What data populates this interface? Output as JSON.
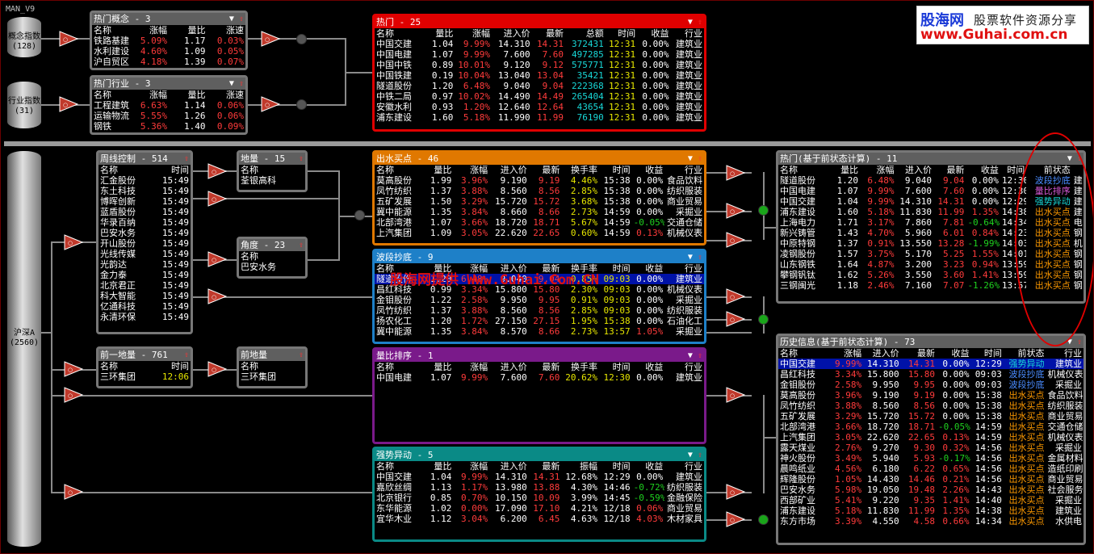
{
  "app": {
    "title": "MAN_V9"
  },
  "logo": {
    "brand": "股海网",
    "slogan": "股票软件资源分享",
    "url": "www.Guhai.com.cn"
  },
  "watermark": "股海网提供 Www.Guhai.Com.CN",
  "sources": {
    "concept": "概念指数",
    "concept_n": "(128)",
    "industry": "行业指数",
    "industry_n": "(31)",
    "market": "沪深A",
    "market_n": "(2560)"
  },
  "hot_concept": {
    "title": "热门概念 - 3",
    "cols": [
      "名称",
      "涨幅",
      "量比",
      "涨速"
    ],
    "rows": [
      [
        "铁路基建",
        "5.09%",
        "1.17",
        "0.03%"
      ],
      [
        "水利建设",
        "4.60%",
        "1.09",
        "0.05%"
      ],
      [
        "沪自贸区",
        "4.18%",
        "1.39",
        "0.07%"
      ]
    ]
  },
  "hot_industry": {
    "title": "热门行业 - 3",
    "cols": [
      "名称",
      "涨幅",
      "量比",
      "涨速"
    ],
    "rows": [
      [
        "工程建筑",
        "6.63%",
        "1.14",
        "0.06%"
      ],
      [
        "运输物流",
        "5.55%",
        "1.26",
        "0.06%"
      ],
      [
        "钢铁",
        "5.36%",
        "1.40",
        "0.09%"
      ]
    ]
  },
  "hot": {
    "title": "热门 - 25",
    "cols": [
      "名称",
      "量比",
      "涨幅",
      "进入价",
      "最新",
      "总额",
      "时间",
      "收益",
      "行业"
    ],
    "rows": [
      [
        "中国交建",
        "1.04",
        "9.99%",
        "14.310",
        "14.31",
        "372431",
        "12:31",
        "0.00%",
        "建筑业"
      ],
      [
        "中国电建",
        "1.07",
        "9.99%",
        "7.600",
        "7.60",
        "497285",
        "12:31",
        "0.00%",
        "建筑业"
      ],
      [
        "中国中铁",
        "0.89",
        "10.01%",
        "9.120",
        "9.12",
        "575771",
        "12:31",
        "0.00%",
        "建筑业"
      ],
      [
        "中国铁建",
        "0.19",
        "10.04%",
        "13.040",
        "13.04",
        "35421",
        "12:31",
        "0.00%",
        "建筑业"
      ],
      [
        "隧道股份",
        "1.20",
        "6.48%",
        "9.040",
        "9.04",
        "222368",
        "12:31",
        "0.00%",
        "建筑业"
      ],
      [
        "中铁二局",
        "0.97",
        "10.02%",
        "14.490",
        "14.49",
        "265404",
        "12:31",
        "0.00%",
        "建筑业"
      ],
      [
        "安徽水利",
        "0.93",
        "1.20%",
        "12.640",
        "12.64",
        "43654",
        "12:31",
        "0.00%",
        "建筑业"
      ],
      [
        "浦东建设",
        "1.60",
        "5.18%",
        "11.990",
        "11.99",
        "76190",
        "12:31",
        "0.00%",
        "建筑业"
      ]
    ]
  },
  "zhouxian": {
    "title": "周线控制 - 514",
    "cols": [
      "名称",
      "时间"
    ],
    "rows": [
      [
        "汇金股份",
        "15:49"
      ],
      [
        "东土科技",
        "15:49"
      ],
      [
        "博晖创新",
        "15:49"
      ],
      [
        "蓝盾股份",
        "15:49"
      ],
      [
        "华录百纳",
        "15:49"
      ],
      [
        "巴安水务",
        "15:49"
      ],
      [
        "开山股份",
        "15:49"
      ],
      [
        "光线传媒",
        "15:49"
      ],
      [
        "光韵达",
        "15:49"
      ],
      [
        "金力泰",
        "15:49"
      ],
      [
        "北京君正",
        "15:49"
      ],
      [
        "科大智能",
        "15:49"
      ],
      [
        "亿通科技",
        "15:49"
      ],
      [
        "永清环保",
        "15:49"
      ]
    ]
  },
  "diliang": {
    "title": "地量 - 15",
    "cols": [
      "名称"
    ],
    "rows": [
      [
        "荃银高科"
      ]
    ]
  },
  "jiaodu": {
    "title": "角度 - 23",
    "cols": [
      "名称"
    ],
    "rows": [
      [
        "巴安水务"
      ]
    ]
  },
  "qianyi": {
    "title": "前一地量 - 761",
    "cols": [
      "名称",
      "时间"
    ],
    "rows": [
      [
        "三环集团",
        "12:06"
      ]
    ]
  },
  "qiandiliang": {
    "title": "前地量",
    "cols": [
      "名称"
    ],
    "rows": [
      [
        "三环集团"
      ]
    ]
  },
  "chushui": {
    "title": "出水买点 - 46",
    "cols": [
      "名称",
      "量比",
      "涨幅",
      "进入价",
      "最新",
      "换手率",
      "时间",
      "收益",
      "行业"
    ],
    "rows": [
      [
        "莫高股份",
        "1.99",
        "3.96%",
        "9.190",
        "9.19",
        "4.46%",
        "15:38",
        "0.00%",
        "食品饮料"
      ],
      [
        "凤竹纺织",
        "1.37",
        "3.88%",
        "8.560",
        "8.56",
        "2.85%",
        "15:38",
        "0.00%",
        "纺织服装"
      ],
      [
        "五矿发展",
        "1.50",
        "3.29%",
        "15.720",
        "15.72",
        "3.68%",
        "15:38",
        "0.00%",
        "商业贸易"
      ],
      [
        "冀中能源",
        "1.35",
        "3.84%",
        "8.660",
        "8.66",
        "2.73%",
        "14:59",
        "0.00%",
        "采掘业"
      ],
      [
        "北部湾港",
        "1.07",
        "3.66%",
        "18.720",
        "18.71",
        "5.67%",
        "14:59",
        "-0.05%",
        "交通仓储"
      ],
      [
        "上汽集团",
        "1.09",
        "3.05%",
        "22.620",
        "22.65",
        "0.60%",
        "14:59",
        "0.13%",
        "机械仪表"
      ]
    ]
  },
  "boduan": {
    "title": "波段抄底 - 9",
    "cols": [
      "名称",
      "量比",
      "涨幅",
      "进入价",
      "最新",
      "换手率",
      "时间",
      "收益",
      "行业"
    ],
    "rows": [
      [
        "隧道股份",
        "1.20",
        "6.48%",
        "9.040",
        "9.04",
        "0.85%",
        "09:03",
        "0.00%",
        "建筑业"
      ],
      [
        "昌红科技",
        "0.99",
        "3.34%",
        "15.800",
        "15.80",
        "2.30%",
        "09:03",
        "0.00%",
        "机械仪表"
      ],
      [
        "金钼股份",
        "1.22",
        "2.58%",
        "9.950",
        "9.95",
        "0.91%",
        "09:03",
        "0.00%",
        "采掘业"
      ],
      [
        "凤竹纺织",
        "1.37",
        "3.88%",
        "8.560",
        "8.56",
        "2.85%",
        "09:03",
        "0.00%",
        "纺织服装"
      ],
      [
        "扬农化工",
        "1.20",
        "1.72%",
        "27.150",
        "27.15",
        "1.95%",
        "15:38",
        "0.00%",
        "石油化工"
      ],
      [
        "冀中能源",
        "1.35",
        "3.84%",
        "8.570",
        "8.66",
        "2.73%",
        "13:57",
        "1.05%",
        "采掘业"
      ]
    ]
  },
  "liangbi": {
    "title": "量比排序 - 1",
    "cols": [
      "名称",
      "量比",
      "涨幅",
      "进入价",
      "最新",
      "换手率",
      "时间",
      "收益",
      "行业"
    ],
    "rows": [
      [
        "中国电建",
        "1.07",
        "9.99%",
        "7.600",
        "7.60",
        "20.62%",
        "12:30",
        "0.00%",
        "建筑业"
      ]
    ]
  },
  "qiangshi": {
    "title": "强势异动 - 5",
    "cols": [
      "名称",
      "量比",
      "涨幅",
      "进入价",
      "最新",
      "振幅",
      "时间",
      "收益",
      "行业"
    ],
    "rows": [
      [
        "中国交建",
        "1.04",
        "9.99%",
        "14.310",
        "14.31",
        "12.68%",
        "12:29",
        "0.00%",
        "建筑业"
      ],
      [
        "嘉欣丝绸",
        "1.13",
        "1.17%",
        "13.980",
        "13.88",
        "4.30%",
        "14:46",
        "-0.72%",
        "纺织服装"
      ],
      [
        "北京银行",
        "0.85",
        "0.70%",
        "10.150",
        "10.09",
        "3.99%",
        "14:45",
        "-0.59%",
        "金融保险"
      ],
      [
        "东华能源",
        "1.02",
        "0.00%",
        "17.090",
        "17.10",
        "4.21%",
        "12/18",
        "0.06%",
        "商业贸易"
      ],
      [
        "宜华木业",
        "1.12",
        "3.04%",
        "6.200",
        "6.45",
        "4.63%",
        "12/18",
        "4.03%",
        "木材家具"
      ]
    ]
  },
  "hot_prev": {
    "title": "热门(基于前状态计算) - 11",
    "cols": [
      "名称",
      "量比",
      "涨幅",
      "进入价",
      "最新",
      "收益",
      "时间",
      "前状态",
      ""
    ],
    "rows": [
      [
        "隧道股份",
        "1.20",
        "6.48%",
        "9.040",
        "9.04",
        "0.00%",
        "12:30",
        "波段抄底",
        "建"
      ],
      [
        "中国电建",
        "1.07",
        "9.99%",
        "7.600",
        "7.60",
        "0.00%",
        "12:30",
        "量比排序",
        "建"
      ],
      [
        "中国交建",
        "1.04",
        "9.99%",
        "14.310",
        "14.31",
        "0.00%",
        "12:29",
        "强势异动",
        "建"
      ],
      [
        "浦东建设",
        "1.60",
        "5.18%",
        "11.830",
        "11.99",
        "1.35%",
        "14:38",
        "出水买点",
        "建"
      ],
      [
        "上海电力",
        "1.71",
        "3.17%",
        "7.860",
        "7.81",
        "-0.64%",
        "14:34",
        "出水买点",
        "电"
      ],
      [
        "新兴铸管",
        "1.43",
        "4.70%",
        "5.960",
        "6.01",
        "0.84%",
        "14:23",
        "出水买点",
        "钢"
      ],
      [
        "中原特钢",
        "1.37",
        "0.91%",
        "13.550",
        "13.28",
        "-1.99%",
        "14:03",
        "出水买点",
        "机"
      ],
      [
        "凌钢股份",
        "1.57",
        "3.75%",
        "5.170",
        "5.25",
        "1.55%",
        "14:01",
        "出水买点",
        "钢"
      ],
      [
        "山东钢铁",
        "1.64",
        "4.87%",
        "3.200",
        "3.23",
        "0.94%",
        "13:59",
        "出水买点",
        "钢"
      ],
      [
        "攀钢钒钛",
        "1.62",
        "5.26%",
        "3.550",
        "3.60",
        "1.41%",
        "13:59",
        "出水买点",
        "钢"
      ],
      [
        "三钢闽光",
        "1.18",
        "2.46%",
        "7.160",
        "7.07",
        "-1.26%",
        "13:57",
        "出水买点",
        "钢"
      ]
    ]
  },
  "history": {
    "title": "历史信息(基于前状态计算) - 73",
    "cols": [
      "名称",
      "涨幅",
      "进入价",
      "最新",
      "收益",
      "时间",
      "前状态",
      "行业"
    ],
    "rows": [
      [
        "中国交建",
        "9.99%",
        "14.310",
        "14.31",
        "0.00%",
        "12:29",
        "强势异动",
        "建筑业"
      ],
      [
        "昌红科技",
        "3.34%",
        "15.800",
        "15.80",
        "0.00%",
        "09:03",
        "波段抄底",
        "机械仪表"
      ],
      [
        "金钼股份",
        "2.58%",
        "9.950",
        "9.95",
        "0.00%",
        "09:03",
        "波段抄底",
        "采掘业"
      ],
      [
        "莫高股份",
        "3.96%",
        "9.190",
        "9.19",
        "0.00%",
        "15:38",
        "出水买点",
        "食品饮料"
      ],
      [
        "凤竹纺织",
        "3.88%",
        "8.560",
        "8.56",
        "0.00%",
        "15:38",
        "出水买点",
        "纺织服装"
      ],
      [
        "五矿发展",
        "3.29%",
        "15.720",
        "15.72",
        "0.00%",
        "15:38",
        "出水买点",
        "商业贸易"
      ],
      [
        "北部湾港",
        "3.66%",
        "18.720",
        "18.71",
        "-0.05%",
        "14:59",
        "出水买点",
        "交通仓储"
      ],
      [
        "上汽集团",
        "3.05%",
        "22.620",
        "22.65",
        "0.13%",
        "14:59",
        "出水买点",
        "机械仪表"
      ],
      [
        "露天煤业",
        "2.76%",
        "9.270",
        "9.30",
        "0.32%",
        "14:56",
        "出水买点",
        "采掘业"
      ],
      [
        "神火股份",
        "3.49%",
        "5.940",
        "5.93",
        "-0.17%",
        "14:56",
        "出水买点",
        "金属材料"
      ],
      [
        "晨鸣纸业",
        "4.56%",
        "6.180",
        "6.22",
        "0.65%",
        "14:56",
        "出水买点",
        "造纸印刷"
      ],
      [
        "辉隆股份",
        "1.05%",
        "14.430",
        "14.46",
        "0.21%",
        "14:56",
        "出水买点",
        "商业贸易"
      ],
      [
        "巴安水务",
        "5.98%",
        "19.050",
        "19.48",
        "2.26%",
        "14:43",
        "出水买点",
        "社会服务"
      ],
      [
        "西部矿业",
        "5.41%",
        "9.220",
        "9.35",
        "1.41%",
        "14:40",
        "出水买点",
        "采掘业"
      ],
      [
        "浦东建设",
        "5.18%",
        "11.830",
        "11.99",
        "1.35%",
        "14:38",
        "出水买点",
        "建筑业"
      ],
      [
        "东方市场",
        "3.39%",
        "4.550",
        "4.58",
        "0.66%",
        "14:34",
        "出水买点",
        "水供电"
      ]
    ]
  }
}
